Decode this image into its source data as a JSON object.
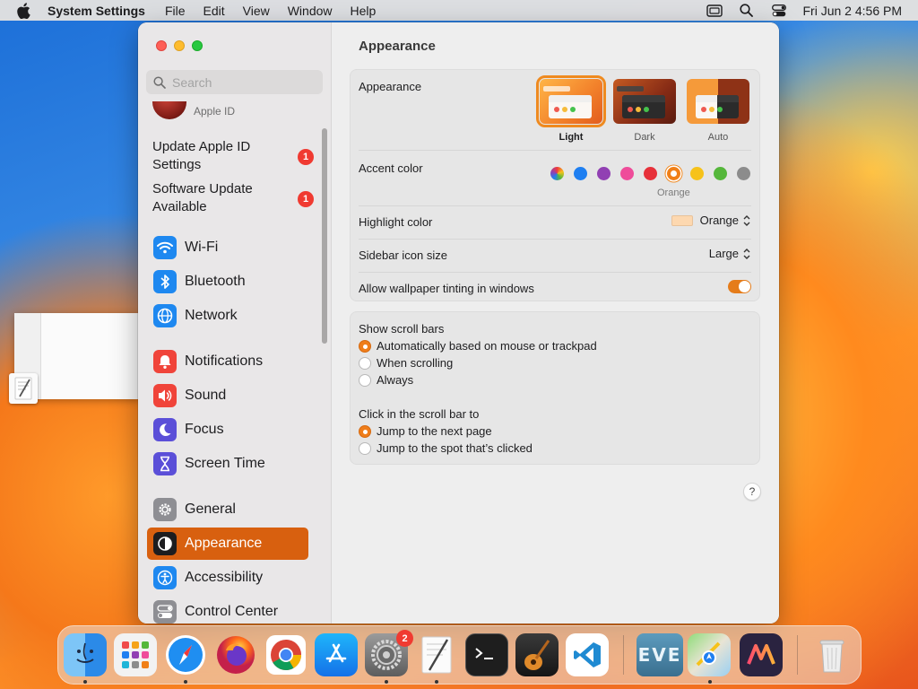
{
  "menubar": {
    "app_name": "System Settings",
    "menus": [
      "File",
      "Edit",
      "View",
      "Window",
      "Help"
    ],
    "clock": "Fri Jun 2  4:56 PM"
  },
  "sidebar": {
    "search_placeholder": "Search",
    "apple_id_label": "Apple ID",
    "notices": [
      {
        "label": "Update Apple ID Settings",
        "badge": "1"
      },
      {
        "label": "Software Update Available",
        "badge": "1"
      }
    ],
    "items": [
      {
        "label": "Wi-Fi",
        "icon": "wifi-icon",
        "color": "#1e88f0"
      },
      {
        "label": "Bluetooth",
        "icon": "bluetooth-icon",
        "color": "#1e88f0"
      },
      {
        "label": "Network",
        "icon": "globe-icon",
        "color": "#1e88f0"
      },
      {
        "label": "Notifications",
        "icon": "bell-icon",
        "color": "#f0443a"
      },
      {
        "label": "Sound",
        "icon": "speaker-icon",
        "color": "#f0443a"
      },
      {
        "label": "Focus",
        "icon": "moon-icon",
        "color": "#5b4fd8"
      },
      {
        "label": "Screen Time",
        "icon": "hourglass-icon",
        "color": "#5b4fd8"
      },
      {
        "label": "General",
        "icon": "gear-icon",
        "color": "#8e8e93"
      },
      {
        "label": "Appearance",
        "icon": "appearance-icon",
        "color": "#1d1d1f",
        "selected": true
      },
      {
        "label": "Accessibility",
        "icon": "accessibility-icon",
        "color": "#1e88f0"
      },
      {
        "label": "Control Center",
        "icon": "control-center-icon",
        "color": "#8e8e93"
      }
    ]
  },
  "main": {
    "title": "Appearance",
    "appearance_label": "Appearance",
    "themes": [
      {
        "label": "Light",
        "selected": true
      },
      {
        "label": "Dark",
        "selected": false
      },
      {
        "label": "Auto",
        "selected": false
      }
    ],
    "accent_label": "Accent color",
    "accent_colors": [
      "multicolor",
      "#1f7ff1",
      "#9140b3",
      "#ef4c9a",
      "#e7313a",
      "#f07f18",
      "#f6c21a",
      "#55b73b",
      "#8c8c8c"
    ],
    "accent_selected_index": 5,
    "accent_selected_name": "Orange",
    "highlight_label": "Highlight color",
    "highlight_value": "Orange",
    "sidebar_icon_label": "Sidebar icon size",
    "sidebar_icon_value": "Large",
    "tinting_label": "Allow wallpaper tinting in windows",
    "tinting_on": true,
    "scroll_bars_label": "Show scroll bars",
    "scroll_bars_options": [
      {
        "label": "Automatically based on mouse or trackpad",
        "selected": true
      },
      {
        "label": "When scrolling",
        "selected": false
      },
      {
        "label": "Always",
        "selected": false
      }
    ],
    "click_label": "Click in the scroll bar to",
    "click_options": [
      {
        "label": "Jump to the next page",
        "selected": true
      },
      {
        "label": "Jump to the spot that’s clicked",
        "selected": false
      }
    ],
    "help": "?"
  },
  "dock": {
    "apps": [
      {
        "name": "Finder",
        "running": true
      },
      {
        "name": "Launchpad",
        "running": false
      },
      {
        "name": "Safari",
        "running": true
      },
      {
        "name": "Firefox",
        "running": false
      },
      {
        "name": "Chrome",
        "running": false
      },
      {
        "name": "App Store",
        "running": false
      },
      {
        "name": "System Settings",
        "running": true,
        "badge": "2"
      },
      {
        "name": "TextEdit",
        "running": true
      },
      {
        "name": "Terminal",
        "running": false
      },
      {
        "name": "GarageBand",
        "running": false
      },
      {
        "name": "Visual Studio Code",
        "running": false
      },
      {
        "name": "EVE Online",
        "running": false
      },
      {
        "name": "Maps",
        "running": true
      },
      {
        "name": "Mimestream",
        "running": false
      },
      {
        "name": "Trash",
        "running": false
      }
    ],
    "eve_label": "EVE"
  }
}
